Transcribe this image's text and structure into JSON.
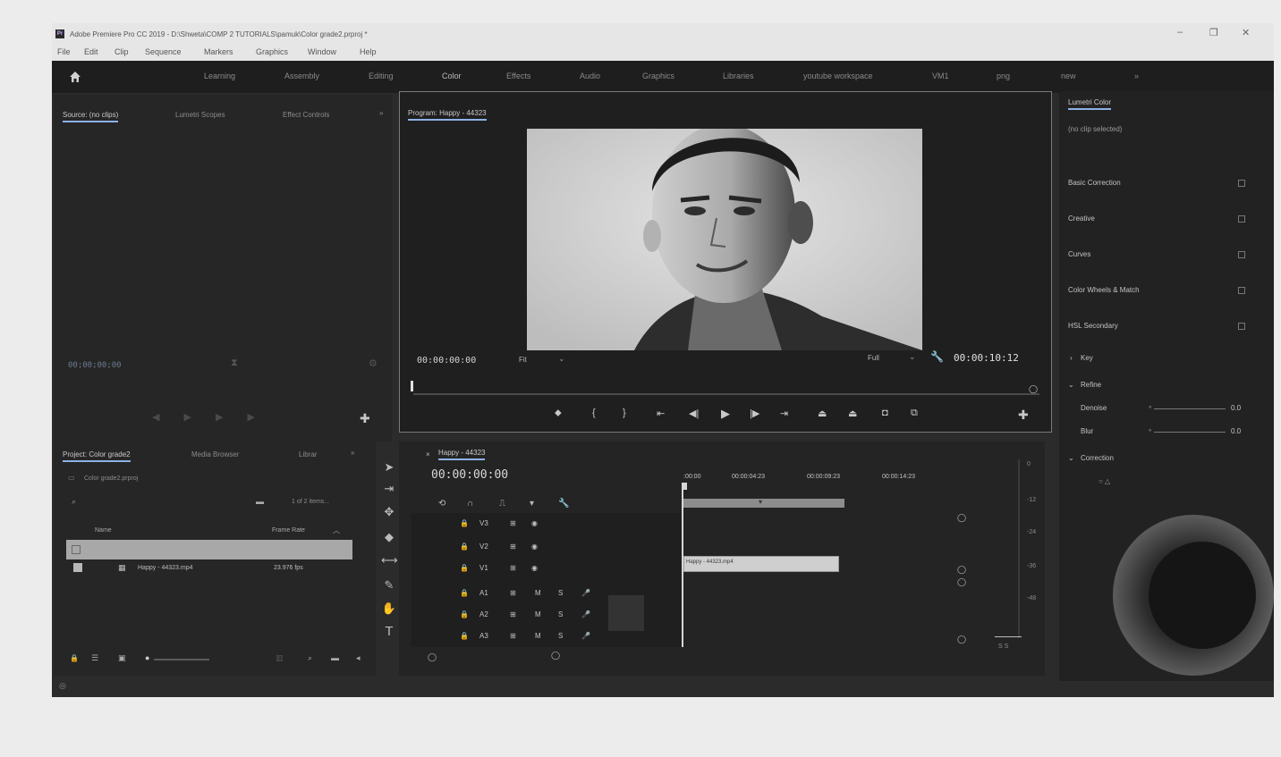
{
  "window": {
    "title": "Adobe Premiere Pro CC 2019 - D:\\Shweta\\COMP 2 TUTORIALS\\pamuk\\Color grade2.prproj *",
    "controls": [
      "–",
      "❐",
      "✕"
    ]
  },
  "menu": [
    "File",
    "Edit",
    "Clip",
    "Sequence",
    "Markers",
    "Graphics",
    "Window",
    "Help"
  ],
  "workspaces": [
    "Learning",
    "Assembly",
    "Editing",
    "Color",
    "Effects",
    "Audio",
    "Graphics",
    "Libraries",
    "youtube workspace",
    "VM1",
    "png",
    "new"
  ],
  "source_panel": {
    "tabs": [
      "Source: (no clips)",
      "Lumetri Scopes",
      "Effect Controls"
    ],
    "timecode": "00;00;00;00"
  },
  "program_monitor": {
    "tab": "Program: Happy - 44323",
    "timecode_in": "00:00:00:00",
    "fit": "Fit",
    "quality": "Full",
    "duration": "00:00:10:12"
  },
  "project_panel": {
    "tabs": [
      "Project: Color grade2",
      "Media Browser",
      "Librar"
    ],
    "file": "Color grade2.prproj",
    "item_count": "1 of 2 items...",
    "col_name": "Name",
    "col_rate": "Frame Rate",
    "clip_name": "Happy - 44323.mp4",
    "clip_rate": "23.976 fps"
  },
  "timeline": {
    "tab": "Happy - 44323",
    "timecode": "00:00:00:00",
    "ruler": [
      ":00:00",
      "00:00:04:23",
      "00:00:09:23",
      "00:00:14:23"
    ],
    "video_tracks": [
      "V3",
      "V2",
      "V1"
    ],
    "audio_tracks": [
      "A1",
      "A2",
      "A3"
    ],
    "clip_label": "Happy - 44323.mp4",
    "meter": [
      "0",
      "-12",
      "-24",
      "-36",
      "-48"
    ],
    "meter_footer": "S S"
  },
  "lumetri": {
    "tab": "Lumetri Color",
    "clip": "(no clip selected)",
    "sections": [
      "Basic Correction",
      "Creative",
      "Curves",
      "Color Wheels & Match",
      "HSL Secondary"
    ],
    "subsections": [
      "Key",
      "Refine"
    ],
    "sliders": [
      {
        "label": "Denoise",
        "value": "0.0"
      },
      {
        "label": "Blur",
        "value": "0.0"
      }
    ],
    "correction": "Correction"
  },
  "colors": {
    "accent": "#8cb2e6",
    "clip_video": "#cfcfcf",
    "bg": "#2b2b2b"
  }
}
